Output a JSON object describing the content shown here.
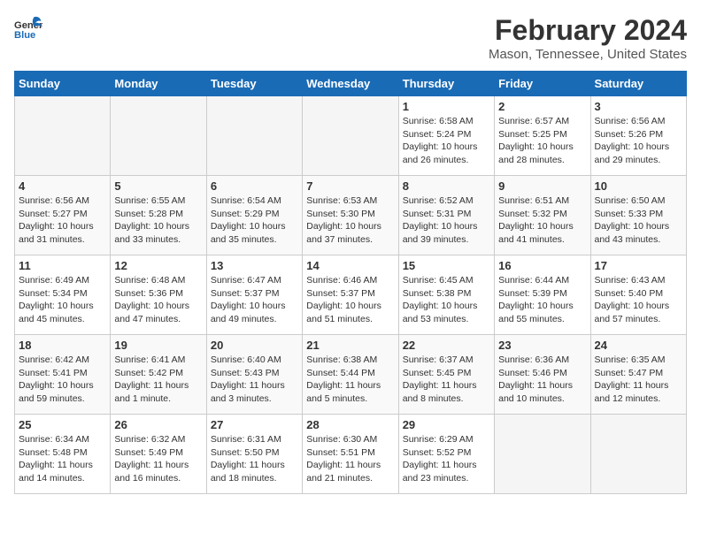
{
  "logo": {
    "line1": "General",
    "line2": "Blue"
  },
  "title": "February 2024",
  "subtitle": "Mason, Tennessee, United States",
  "days_of_week": [
    "Sunday",
    "Monday",
    "Tuesday",
    "Wednesday",
    "Thursday",
    "Friday",
    "Saturday"
  ],
  "weeks": [
    [
      {
        "day": "",
        "empty": true
      },
      {
        "day": "",
        "empty": true
      },
      {
        "day": "",
        "empty": true
      },
      {
        "day": "",
        "empty": true
      },
      {
        "day": "1",
        "sunrise": "6:58 AM",
        "sunset": "5:24 PM",
        "daylight": "10 hours and 26 minutes."
      },
      {
        "day": "2",
        "sunrise": "6:57 AM",
        "sunset": "5:25 PM",
        "daylight": "10 hours and 28 minutes."
      },
      {
        "day": "3",
        "sunrise": "6:56 AM",
        "sunset": "5:26 PM",
        "daylight": "10 hours and 29 minutes."
      }
    ],
    [
      {
        "day": "4",
        "sunrise": "6:56 AM",
        "sunset": "5:27 PM",
        "daylight": "10 hours and 31 minutes."
      },
      {
        "day": "5",
        "sunrise": "6:55 AM",
        "sunset": "5:28 PM",
        "daylight": "10 hours and 33 minutes."
      },
      {
        "day": "6",
        "sunrise": "6:54 AM",
        "sunset": "5:29 PM",
        "daylight": "10 hours and 35 minutes."
      },
      {
        "day": "7",
        "sunrise": "6:53 AM",
        "sunset": "5:30 PM",
        "daylight": "10 hours and 37 minutes."
      },
      {
        "day": "8",
        "sunrise": "6:52 AM",
        "sunset": "5:31 PM",
        "daylight": "10 hours and 39 minutes."
      },
      {
        "day": "9",
        "sunrise": "6:51 AM",
        "sunset": "5:32 PM",
        "daylight": "10 hours and 41 minutes."
      },
      {
        "day": "10",
        "sunrise": "6:50 AM",
        "sunset": "5:33 PM",
        "daylight": "10 hours and 43 minutes."
      }
    ],
    [
      {
        "day": "11",
        "sunrise": "6:49 AM",
        "sunset": "5:34 PM",
        "daylight": "10 hours and 45 minutes."
      },
      {
        "day": "12",
        "sunrise": "6:48 AM",
        "sunset": "5:36 PM",
        "daylight": "10 hours and 47 minutes."
      },
      {
        "day": "13",
        "sunrise": "6:47 AM",
        "sunset": "5:37 PM",
        "daylight": "10 hours and 49 minutes."
      },
      {
        "day": "14",
        "sunrise": "6:46 AM",
        "sunset": "5:37 PM",
        "daylight": "10 hours and 51 minutes."
      },
      {
        "day": "15",
        "sunrise": "6:45 AM",
        "sunset": "5:38 PM",
        "daylight": "10 hours and 53 minutes."
      },
      {
        "day": "16",
        "sunrise": "6:44 AM",
        "sunset": "5:39 PM",
        "daylight": "10 hours and 55 minutes."
      },
      {
        "day": "17",
        "sunrise": "6:43 AM",
        "sunset": "5:40 PM",
        "daylight": "10 hours and 57 minutes."
      }
    ],
    [
      {
        "day": "18",
        "sunrise": "6:42 AM",
        "sunset": "5:41 PM",
        "daylight": "10 hours and 59 minutes."
      },
      {
        "day": "19",
        "sunrise": "6:41 AM",
        "sunset": "5:42 PM",
        "daylight": "11 hours and 1 minute."
      },
      {
        "day": "20",
        "sunrise": "6:40 AM",
        "sunset": "5:43 PM",
        "daylight": "11 hours and 3 minutes."
      },
      {
        "day": "21",
        "sunrise": "6:38 AM",
        "sunset": "5:44 PM",
        "daylight": "11 hours and 5 minutes."
      },
      {
        "day": "22",
        "sunrise": "6:37 AM",
        "sunset": "5:45 PM",
        "daylight": "11 hours and 8 minutes."
      },
      {
        "day": "23",
        "sunrise": "6:36 AM",
        "sunset": "5:46 PM",
        "daylight": "11 hours and 10 minutes."
      },
      {
        "day": "24",
        "sunrise": "6:35 AM",
        "sunset": "5:47 PM",
        "daylight": "11 hours and 12 minutes."
      }
    ],
    [
      {
        "day": "25",
        "sunrise": "6:34 AM",
        "sunset": "5:48 PM",
        "daylight": "11 hours and 14 minutes."
      },
      {
        "day": "26",
        "sunrise": "6:32 AM",
        "sunset": "5:49 PM",
        "daylight": "11 hours and 16 minutes."
      },
      {
        "day": "27",
        "sunrise": "6:31 AM",
        "sunset": "5:50 PM",
        "daylight": "11 hours and 18 minutes."
      },
      {
        "day": "28",
        "sunrise": "6:30 AM",
        "sunset": "5:51 PM",
        "daylight": "11 hours and 21 minutes."
      },
      {
        "day": "29",
        "sunrise": "6:29 AM",
        "sunset": "5:52 PM",
        "daylight": "11 hours and 23 minutes."
      },
      {
        "day": "",
        "empty": true
      },
      {
        "day": "",
        "empty": true
      }
    ]
  ],
  "labels": {
    "sunrise_prefix": "Sunrise: ",
    "sunset_prefix": "Sunset: ",
    "daylight_prefix": "Daylight: "
  }
}
